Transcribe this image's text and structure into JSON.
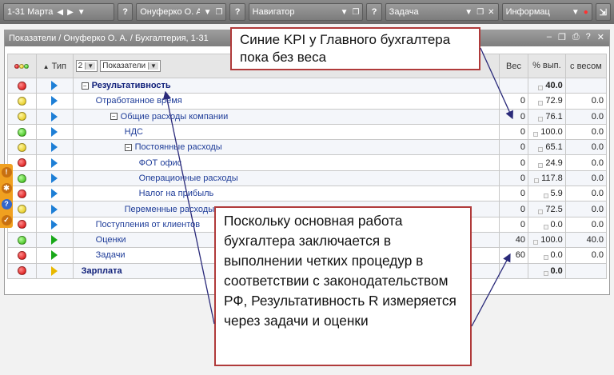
{
  "topbar": {
    "period": "1-31 Марта",
    "user": "Онуферко О. А.",
    "navigator": "Навигатор",
    "task": "Задача",
    "info": "Информац"
  },
  "panel": {
    "breadcrumb": "Показатели / Онуферко О. А. / Бухгалтерия, 1-31"
  },
  "table": {
    "headers": {
      "type": "Тип",
      "level": "2",
      "indicators": "Показатели",
      "weight": "Вес",
      "pct_done": "% вып.",
      "weighted": "с весом"
    },
    "rows": [
      {
        "light": "red",
        "tri": "blue",
        "name": "Результативность",
        "weight": "",
        "pct": "40.0",
        "weighted": ""
      },
      {
        "light": "yellow",
        "tri": "blue",
        "name": "Отработанное время",
        "weight": "0",
        "pct": "72.9",
        "weighted": "0.0"
      },
      {
        "light": "yellow",
        "tri": "blue",
        "name": "Общие расходы компании",
        "weight": "0",
        "pct": "76.1",
        "weighted": "0.0"
      },
      {
        "light": "green",
        "tri": "blue",
        "name": "НДС",
        "weight": "0",
        "pct": "100.0",
        "weighted": "0.0"
      },
      {
        "light": "yellow",
        "tri": "blue",
        "name": "Постоянные расходы",
        "weight": "0",
        "pct": "65.1",
        "weighted": "0.0"
      },
      {
        "light": "red",
        "tri": "blue",
        "name": "ФОТ офис",
        "weight": "0",
        "pct": "24.9",
        "weighted": "0.0"
      },
      {
        "light": "green",
        "tri": "blue",
        "name": "Операционные расходы",
        "weight": "0",
        "pct": "117.8",
        "weighted": "0.0"
      },
      {
        "light": "red",
        "tri": "blue",
        "name": "Налог на прибыль",
        "weight": "0",
        "pct": "5.9",
        "weighted": "0.0"
      },
      {
        "light": "yellow",
        "tri": "blue",
        "name": "Переменные расходы",
        "weight": "0",
        "pct": "72.5",
        "weighted": "0.0"
      },
      {
        "light": "red",
        "tri": "blue",
        "name": "Поступления от клиентов",
        "weight": "0",
        "pct": "0.0",
        "weighted": "0.0"
      },
      {
        "light": "green",
        "tri": "green",
        "name": "Оценки",
        "weight": "40",
        "pct": "100.0",
        "weighted": "40.0"
      },
      {
        "light": "red",
        "tri": "green",
        "name": "Задачи",
        "weight": "60",
        "pct": "0.0",
        "weighted": "0.0"
      },
      {
        "light": "red",
        "tri": "yellow",
        "name": "Зарплата",
        "weight": "",
        "pct": "0.0",
        "weighted": ""
      }
    ]
  },
  "callouts": {
    "top": "Синие KPI у Главного бухгалтера пока без веса",
    "bottom": "Поскольку основная работа бухгалтера заключается в выполнении четких процедур в соответствии с законодательством РФ, Результативность R измеряется через задачи и оценки"
  }
}
